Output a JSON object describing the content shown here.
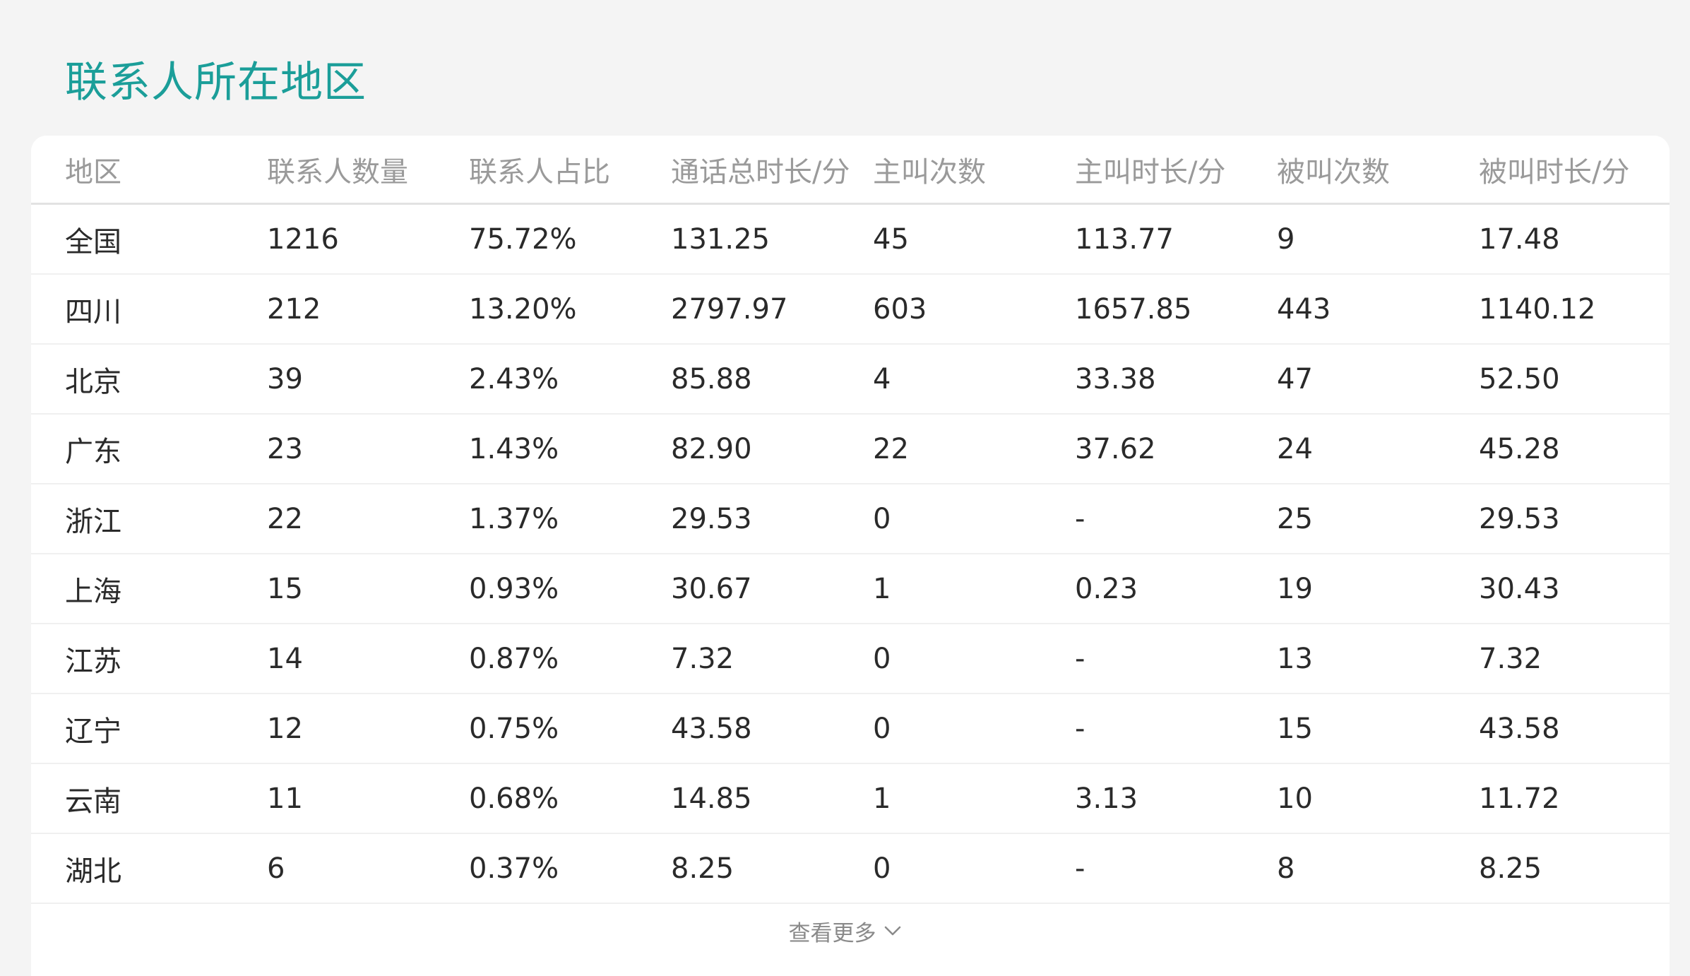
{
  "title": "联系人所在地区",
  "table": {
    "headers": [
      "地区",
      "联系人数量",
      "联系人占比",
      "通话总时长/分",
      "主叫次数",
      "主叫时长/分",
      "被叫次数",
      "被叫时长/分"
    ],
    "rows": [
      [
        "全国",
        "1216",
        "75.72%",
        "131.25",
        "45",
        "113.77",
        "9",
        "17.48"
      ],
      [
        "四川",
        "212",
        "13.20%",
        "2797.97",
        "603",
        "1657.85",
        "443",
        "1140.12"
      ],
      [
        "北京",
        "39",
        "2.43%",
        "85.88",
        "4",
        "33.38",
        "47",
        "52.50"
      ],
      [
        "广东",
        "23",
        "1.43%",
        "82.90",
        "22",
        "37.62",
        "24",
        "45.28"
      ],
      [
        "浙江",
        "22",
        "1.37%",
        "29.53",
        "0",
        "-",
        "25",
        "29.53"
      ],
      [
        "上海",
        "15",
        "0.93%",
        "30.67",
        "1",
        "0.23",
        "19",
        "30.43"
      ],
      [
        "江苏",
        "14",
        "0.87%",
        "7.32",
        "0",
        "-",
        "13",
        "7.32"
      ],
      [
        "辽宁",
        "12",
        "0.75%",
        "43.58",
        "0",
        "-",
        "15",
        "43.58"
      ],
      [
        "云南",
        "11",
        "0.68%",
        "14.85",
        "1",
        "3.13",
        "10",
        "11.72"
      ],
      [
        "湖北",
        "6",
        "0.37%",
        "8.25",
        "0",
        "-",
        "8",
        "8.25"
      ]
    ]
  },
  "more_label": "查看更多",
  "more_icon": "chevron-down-icon",
  "colors": {
    "title": "#1b9e99",
    "background": "#f4f4f4",
    "card": "#ffffff",
    "header_text": "#9a9a9a",
    "body_text": "#2a2a2a"
  }
}
